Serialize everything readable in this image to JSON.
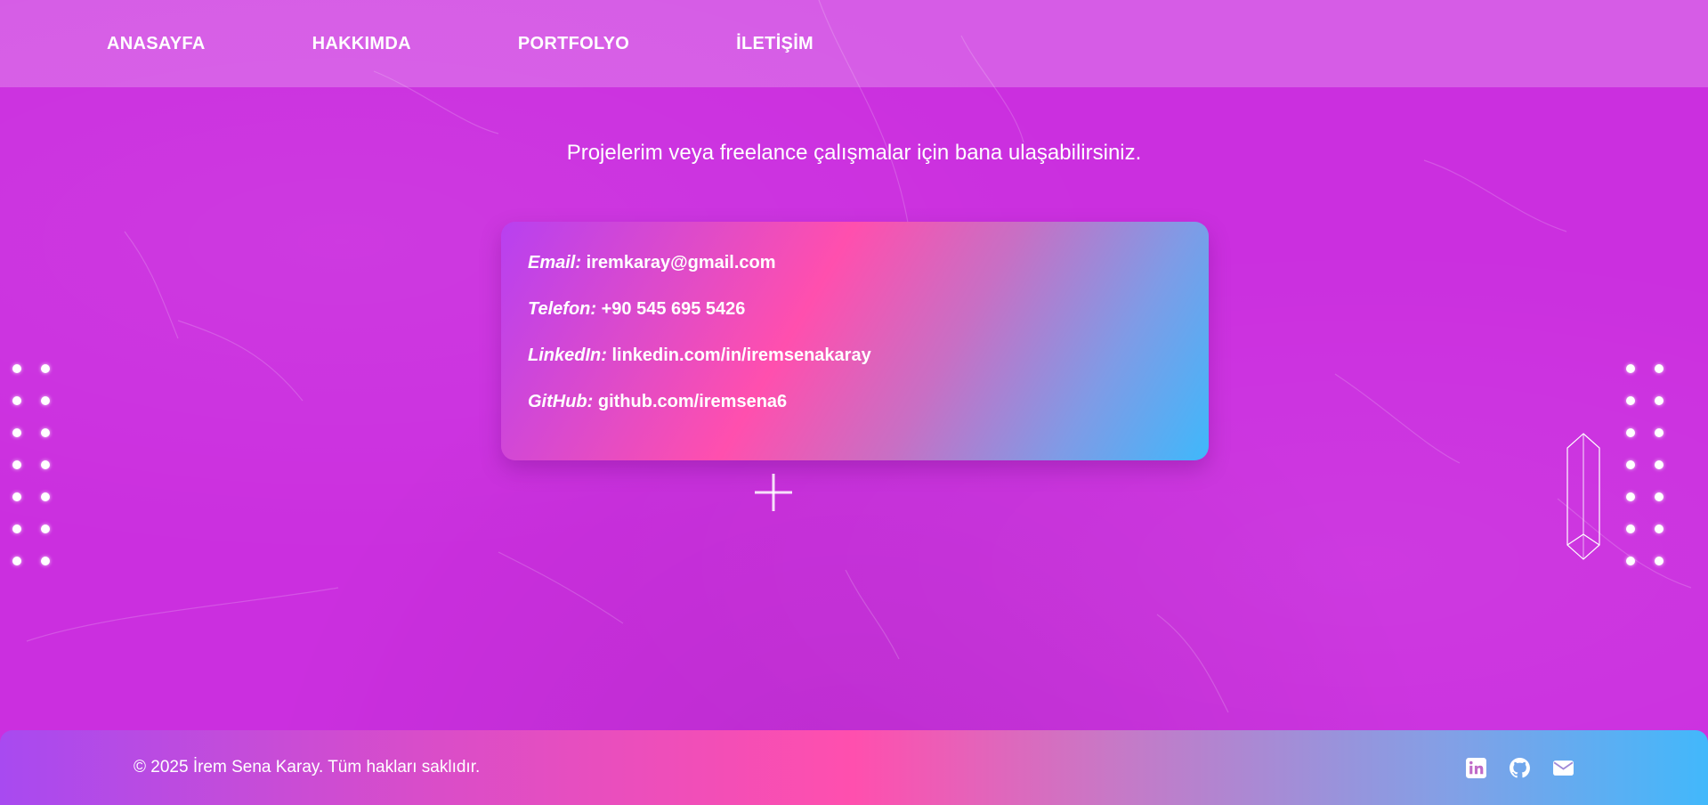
{
  "nav": {
    "items": [
      {
        "label": "ANASAYFA"
      },
      {
        "label": "HAKKIMDA"
      },
      {
        "label": "PORTFOLYO"
      },
      {
        "label": "İLETİŞİM"
      }
    ]
  },
  "intro": {
    "text": "Projelerim veya freelance çalışmalar için bana ulaşabilirsiniz."
  },
  "contact": {
    "rows": [
      {
        "key": "Email:",
        "value": "iremkaray@gmail.com"
      },
      {
        "key": "Telefon:",
        "value": "+90 545 695 5426"
      },
      {
        "key": "LinkedIn:",
        "value": "linkedin.com/in/iremsenakaray"
      },
      {
        "key": "GitHub:",
        "value": "github.com/iremsena6"
      }
    ]
  },
  "footer": {
    "copyright": "© 2025 İrem Sena Karay. Tüm hakları saklıdır.",
    "icons": [
      "linkedin-icon",
      "github-icon",
      "envelope-icon"
    ]
  },
  "colors": {
    "background": "#cb2fdf",
    "navbar": "rgba(255,255,255,0.22)",
    "gradient_start": "#a84af0",
    "gradient_mid": "#ff4fae",
    "gradient_end": "#42b8fb"
  }
}
